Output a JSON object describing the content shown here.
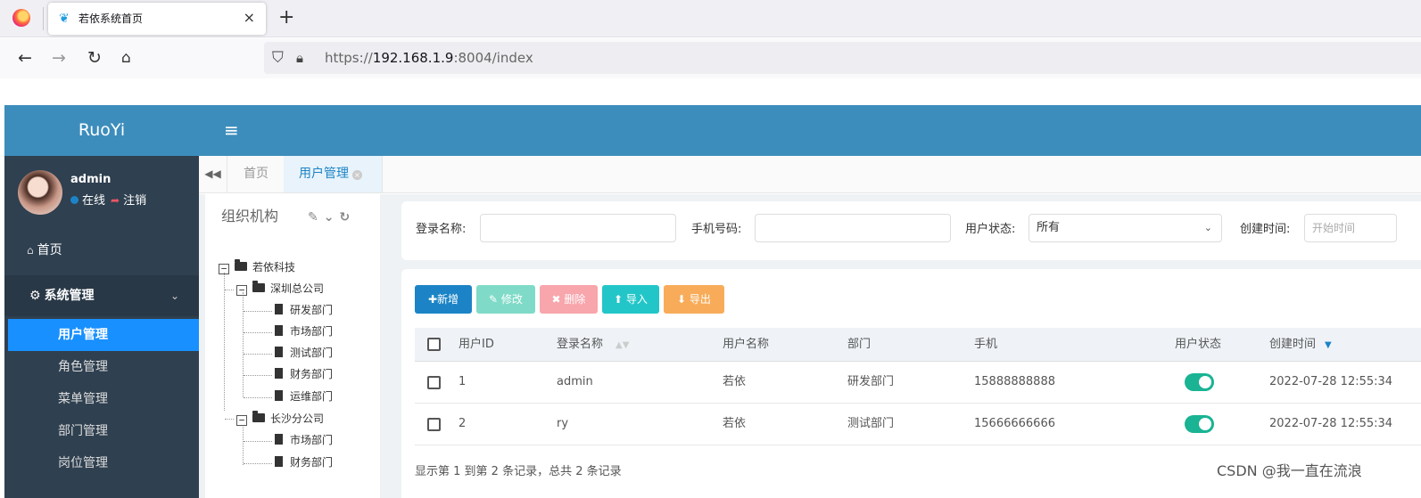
{
  "browser": {
    "tab_favicon": "ruoyi-leaf-icon",
    "tab_title": "若依系统首页",
    "tab_close": "×",
    "new_tab": "+",
    "url_prefix": "https://",
    "url_host": "192.168.1.9",
    "url_suffix": ":8004/index",
    "nav_icons": [
      "back-arrow-icon",
      "forward-arrow-icon",
      "reload-icon",
      "home-icon",
      "shield-icon",
      "lock-icon"
    ]
  },
  "app": {
    "logo": "RuoYi",
    "menu_toggle": "≡",
    "accent_color": "#3c8dbc",
    "sidebar_color": "#2f4050",
    "active_menu_color": "#1890ff"
  },
  "user": {
    "name": "admin",
    "status": "在线",
    "logout": "注销"
  },
  "sidebar": {
    "home": "首页",
    "group_label": "系统管理",
    "items": [
      {
        "label": "用户管理",
        "active": true
      },
      {
        "label": "角色管理",
        "active": false
      },
      {
        "label": "菜单管理",
        "active": false
      },
      {
        "label": "部门管理",
        "active": false
      },
      {
        "label": "岗位管理",
        "active": false
      }
    ]
  },
  "content_tabs": {
    "scroll_left": "◀◀",
    "home": "首页",
    "active": "用户管理",
    "close": "×"
  },
  "tree": {
    "title": "组织机构",
    "tools": [
      "edit-icon",
      "chevron-down-icon",
      "refresh-icon"
    ],
    "root": "若依科技",
    "branch1": "深圳总公司",
    "branch1_children": [
      "研发部门",
      "市场部门",
      "测试部门",
      "财务部门",
      "运维部门"
    ],
    "branch2": "长沙分公司",
    "branch2_children": [
      "市场部门",
      "财务部门"
    ],
    "toggle_open": "−"
  },
  "search": {
    "login_name_label": "登录名称:",
    "phone_label": "手机号码:",
    "status_label": "用户状态:",
    "status_value": "所有",
    "created_label": "创建时间:",
    "start_placeholder": "开始时间"
  },
  "toolbar": {
    "add": "新增",
    "edit": "修改",
    "delete": "删除",
    "import": "导入",
    "export": "导出"
  },
  "table": {
    "columns": [
      "用户ID",
      "登录名称",
      "用户名称",
      "部门",
      "手机",
      "用户状态",
      "创建时间"
    ],
    "rows": [
      {
        "id": "1",
        "login": "admin",
        "name": "若依",
        "dept": "研发部门",
        "phone": "15888888888",
        "enabled": true,
        "created": "2022-07-28 12:55:34"
      },
      {
        "id": "2",
        "login": "ry",
        "name": "若依",
        "dept": "测试部门",
        "phone": "15666666666",
        "enabled": true,
        "created": "2022-07-28 12:55:34"
      }
    ],
    "footer": "显示第 1 到第 2 条记录，总共 2 条记录"
  },
  "watermark": "CSDN @我一直在流浪"
}
